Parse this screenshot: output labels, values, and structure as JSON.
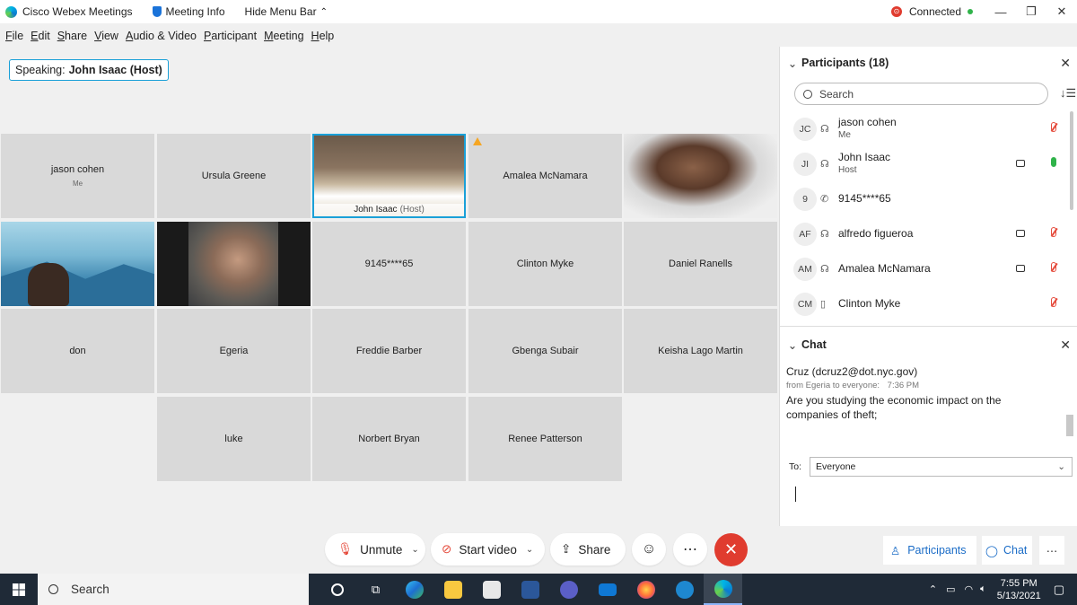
{
  "titlebar": {
    "app_name": "Cisco Webex Meetings",
    "meeting_info": "Meeting Info",
    "hide_menu_bar": "Hide Menu Bar",
    "status": "Connected",
    "minimize": "—",
    "restore": "❐",
    "close": "✕"
  },
  "menu": [
    "File",
    "Edit",
    "Share",
    "View",
    "Audio & Video",
    "Participant",
    "Meeting",
    "Help"
  ],
  "speaking": {
    "label": "Speaking:",
    "name": "John Isaac (Host)"
  },
  "tiles": [
    {
      "name": "jason cohen",
      "sub": "Me"
    },
    {
      "name": "Ursula Greene"
    },
    {
      "name": "John Isaac",
      "role": "(Host)"
    },
    {
      "name": "Amalea McNamara"
    },
    {
      "name": "9145****65"
    },
    {
      "name": "Clinton Myke"
    },
    {
      "name": "Daniel Ranells"
    },
    {
      "name": "don"
    },
    {
      "name": "Egeria"
    },
    {
      "name": "Freddie Barber"
    },
    {
      "name": "Gbenga Subair"
    },
    {
      "name": "Keisha Lago Martin"
    },
    {
      "name": "luke"
    },
    {
      "name": "Norbert Bryan"
    },
    {
      "name": "Renee Patterson"
    }
  ],
  "participants_panel": {
    "title": "Participants (18)",
    "search_placeholder": "Search",
    "list": [
      {
        "initials": "JC",
        "name": "jason cohen",
        "role": "Me",
        "audio_icon": "headset-icon",
        "video": false,
        "mic": "muted"
      },
      {
        "initials": "JI",
        "name": "John Isaac",
        "role": "Host",
        "audio_icon": "headset-icon",
        "video": true,
        "mic": "live"
      },
      {
        "initials": "9",
        "name": "9145****65",
        "role": "",
        "audio_icon": "phone-icon",
        "video": false,
        "mic": "none"
      },
      {
        "initials": "AF",
        "name": "alfredo figueroa",
        "role": "",
        "audio_icon": "headset-icon",
        "video": true,
        "mic": "muted"
      },
      {
        "initials": "AM",
        "name": "Amalea McNamara",
        "role": "",
        "audio_icon": "headset-icon",
        "video": true,
        "mic": "muted"
      },
      {
        "initials": "CM",
        "name": "Clinton Myke",
        "role": "",
        "audio_icon": "mobile-icon",
        "video": false,
        "mic": "muted"
      }
    ]
  },
  "chat_panel": {
    "title": "Chat",
    "lines": [
      {
        "text": "Cruz (dcruz2@dot.nyc.gov)"
      },
      {
        "meta": "from Egeria to everyone:",
        "time": "7:36 PM"
      },
      {
        "text": "Are you studying the economic impact on the companies of theft;"
      }
    ],
    "to_label": "To:",
    "to_value": "Everyone"
  },
  "controls": {
    "unmute": "Unmute",
    "start_video": "Start video",
    "share": "Share",
    "participants": "Participants",
    "chat": "Chat"
  },
  "taskbar": {
    "search": "Search",
    "time": "7:55 PM",
    "date": "5/13/2021"
  },
  "colors": {
    "accent": "#1aa0d8",
    "end_call": "#e03c2f",
    "connected": "#30b34a",
    "link": "#1a6cc7"
  }
}
